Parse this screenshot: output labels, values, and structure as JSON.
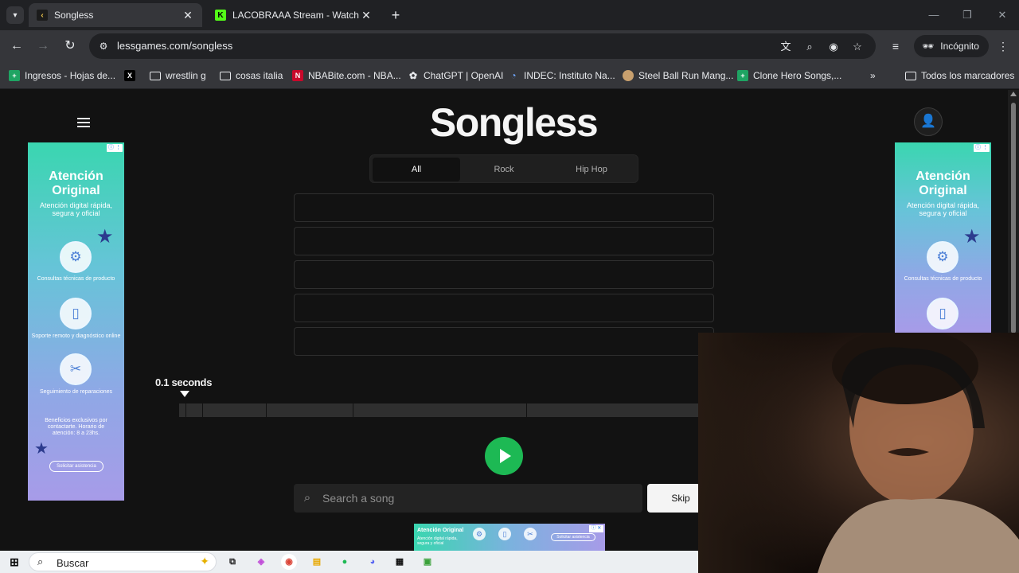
{
  "browser": {
    "tabs": [
      {
        "title": "Songless",
        "active": true
      },
      {
        "title": "LACOBRAAA Stream - Watch Li",
        "active": false
      }
    ],
    "url": "lessgames.com/songless",
    "incognito_label": "Incógnito",
    "bookmarks": [
      "Ingresos - Hojas de...",
      "wrestlin g",
      "cosas italia",
      "NBABite.com - NBA...",
      "ChatGPT | OpenAI",
      "INDEC: Instituto Na...",
      "Steel Ball Run Mang...",
      "Clone Hero Songs,..."
    ],
    "all_bookmarks_label": "Todos los marcadores"
  },
  "page": {
    "logo": "Songless",
    "genres": [
      "All",
      "Rock",
      "Hip Hop"
    ],
    "selected_genre": "All",
    "guess_slots": 5,
    "duration_label": "0.1 seconds",
    "search_placeholder": "Search a song",
    "skip_label": "Skip"
  },
  "ads": {
    "title": "Atención Original",
    "subtitle": "Atención digital rápida, segura y oficial",
    "item1": "Consultas técnicas de producto",
    "item2": "Soporte remoto y diagnóstico online",
    "item3": "Seguimiento de reparaciones",
    "benefits": "Beneficios exclusivos por contactarte. Horario de atención: 8 a 23hs.",
    "cta": "Solicitar asistencia",
    "bottom_title": "Atención Original",
    "bottom_sub": "Atención digital rápida, segura y oficial"
  },
  "taskbar": {
    "search_label": "Buscar"
  },
  "colors": {
    "accent_green": "#1db954",
    "page_bg": "#121212"
  }
}
